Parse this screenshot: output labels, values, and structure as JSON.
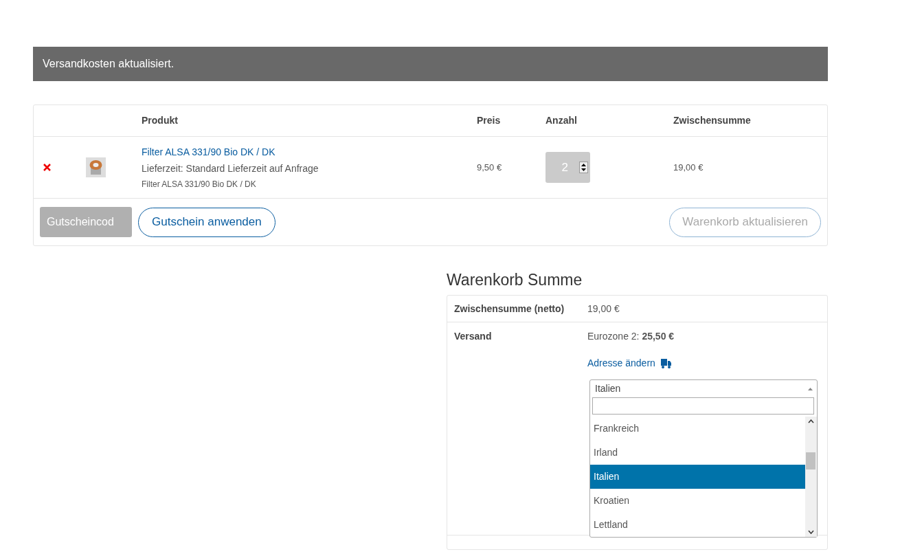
{
  "notice": {
    "text": "Versandkosten aktualisiert."
  },
  "cart": {
    "columns": [
      "Produkt",
      "Preis",
      "Anzahl",
      "Zwischensumme"
    ],
    "rows": [
      {
        "name": "Filter ALSA 331/90 Bio DK / DK",
        "delivery": "Lieferzeit: Standard Lieferzeit auf Anfrage",
        "variant": "Filter ALSA 331/90 Bio DK / DK",
        "price": "9,50 €",
        "quantity": "2",
        "subtotal": "19,00 €"
      }
    ],
    "coupon": {
      "placeholder": "Gutscheincod",
      "apply": "Gutschein anwenden"
    },
    "update": {
      "label": "Warenkorb aktualisieren",
      "disabled": true
    }
  },
  "totals": {
    "title": "Warenkorb Summe",
    "subtotal": {
      "label": "Zwischensumme (netto)",
      "value": "19,00 €"
    },
    "shipping": {
      "label": "Versand",
      "value": "Eurozone 2: **25,50 €**",
      "change_address": "Adresse ändern",
      "country_select": {
        "value": "Italien",
        "expanded": true,
        "options": [
          {
            "label": "Frankreich",
            "selected": false
          },
          {
            "label": "Irland",
            "selected": false
          },
          {
            "label": "Italien",
            "selected": true
          },
          {
            "label": "Kroatien",
            "selected": false
          },
          {
            "label": "Lettland",
            "selected": false
          }
        ]
      }
    }
  }
}
